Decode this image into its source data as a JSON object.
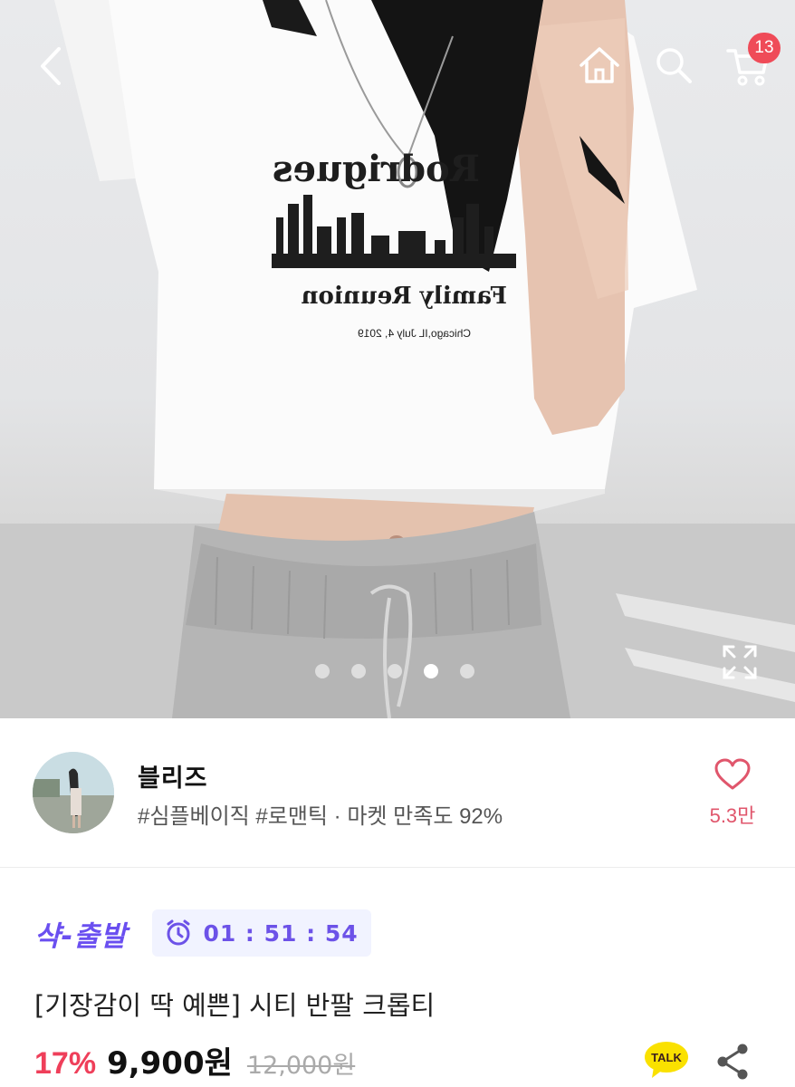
{
  "header": {
    "back_icon": "chevron-left-icon",
    "home_icon": "home-icon",
    "search_icon": "search-icon",
    "cart_icon": "cart-icon",
    "cart_badge": "13"
  },
  "gallery": {
    "image_count": 5,
    "active_index": 4,
    "expand_icon": "expand-icon"
  },
  "shop": {
    "name": "블리즈",
    "tags": "#심플베이직 #로맨틱 · 마켓 만족도 92%",
    "like_icon": "heart-icon",
    "like_count": "5.3만"
  },
  "deal": {
    "label": "샥-출발",
    "timer_icon": "alarm-clock-icon",
    "timer": "01 : 51 : 54"
  },
  "product": {
    "title": "[기장감이 딱 예쁜] 시티 반팔 크롭티",
    "discount": "17%",
    "price": "9,900원",
    "original_price": "12,000원",
    "talk_label": "TALK",
    "share_icon": "share-icon"
  },
  "colors": {
    "accent_purple": "#6a4ff0",
    "discount_red": "#ef3f5a",
    "badge_red": "#ef4b58",
    "talk_yellow": "#fae100"
  }
}
